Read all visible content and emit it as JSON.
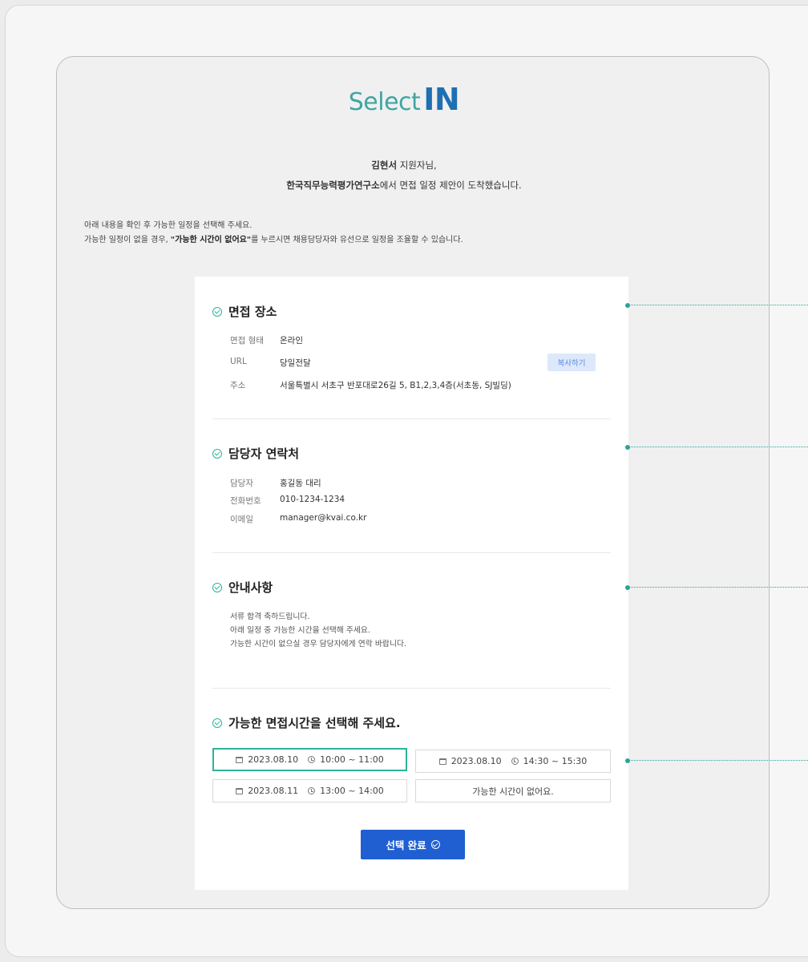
{
  "logo": {
    "part1": "Select",
    "part2": "IN"
  },
  "greeting": {
    "name": "김현서",
    "name_suffix": " 지원자님,",
    "org": "한국직무능력평가연구소",
    "org_suffix": "에서 면접 일정 제안이 도착했습니다."
  },
  "intro": {
    "line1": "아래 내용을 확인 후 가능한 일정을 선택해 주세요.",
    "line2_pre": "가능한 일정이 없을 경우, ",
    "line2_bold": "\"가능한 시간이 없어요\"",
    "line2_post": "를 누르시면 채용담당자와 유선으로 일정을 조율할 수 있습니다."
  },
  "location": {
    "title": "면접 장소",
    "rows": [
      {
        "key": "면접 형태",
        "value": "온라인"
      },
      {
        "key": "URL",
        "value": "당일전달"
      },
      {
        "key": "주소",
        "value": "서울특별시 서초구 반포대로26길 5, B1,2,3,4층(서초동, SJ빌딩)"
      }
    ],
    "copy_label": "복사하기"
  },
  "contact": {
    "title": "담당자 연락처",
    "rows": [
      {
        "key": "담당자",
        "value": "홍길동 대리"
      },
      {
        "key": "전화번호",
        "value": "010-1234-1234"
      },
      {
        "key": "이메일",
        "value": "manager@kvai.co.kr"
      }
    ]
  },
  "notice": {
    "title": "안내사항",
    "lines": [
      "서류 합격 축하드립니다.",
      "아래 일정 중 가능한 시간을 선택해 주세요.",
      "가능한 시간이 없으실 경우 담당자에게 연락 바랍니다."
    ]
  },
  "schedule": {
    "title": "가능한 면접시간을 선택해 주세요.",
    "slots": [
      {
        "date": "2023.08.10",
        "time": "10:00 ~ 11:00",
        "selected": true
      },
      {
        "date": "2023.08.10",
        "time": "14:30 ~ 15:30",
        "selected": false
      },
      {
        "date": "2023.08.11",
        "time": "13:00 ~ 14:00",
        "selected": false
      }
    ],
    "none_label": "가능한 시간이 없어요."
  },
  "submit_label": "선택 완료",
  "colors": {
    "accent": "#2bb39b",
    "primary": "#1f5fd1",
    "logo_teal": "#3fa6a2",
    "logo_blue": "#1f6fb2"
  }
}
